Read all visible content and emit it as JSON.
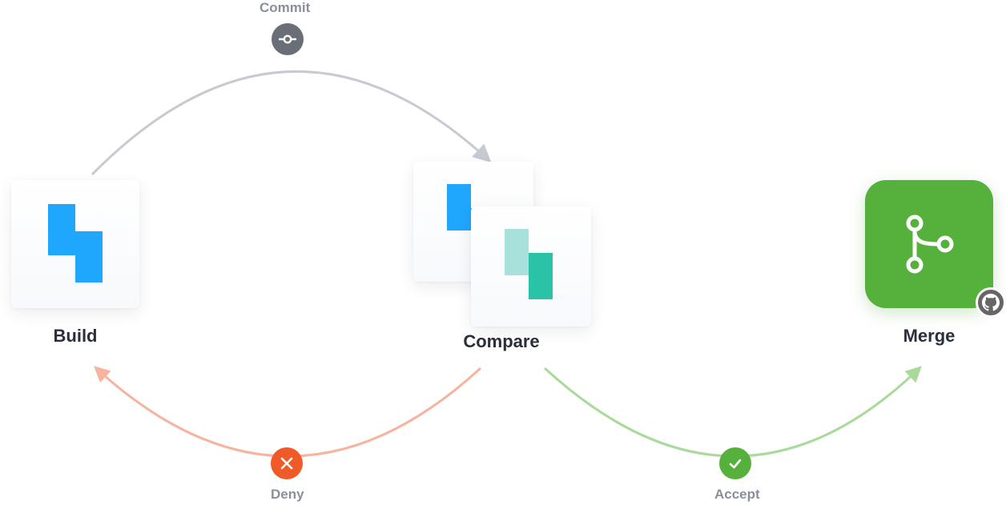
{
  "nodes": {
    "build": {
      "label": "Build"
    },
    "compare": {
      "label": "Compare"
    },
    "merge": {
      "label": "Merge"
    }
  },
  "edges": {
    "commit": {
      "label": "Commit"
    },
    "deny": {
      "label": "Deny"
    },
    "accept": {
      "label": "Accept"
    }
  },
  "colors": {
    "blue": "#1ea7fd",
    "teal": "#2bc3a8",
    "teal_light": "#a8e0db",
    "green": "#56b03c",
    "orange": "#f05a28",
    "gray_arrow": "#c7cad1",
    "text_muted": "#8a8f99"
  }
}
